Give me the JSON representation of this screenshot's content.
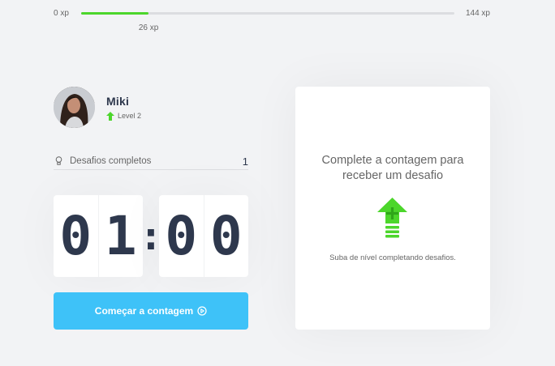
{
  "xp": {
    "min_label": "0 xp",
    "max_label": "144 xp",
    "current_label": "26 xp",
    "current": 26,
    "max": 144,
    "fill_color": "#4cd62b"
  },
  "profile": {
    "name": "Miki",
    "level_label": "Level 2",
    "level_icon": "level-up-arrow-icon"
  },
  "challenges": {
    "label": "Desafios completos",
    "count": "1",
    "icon": "lightbulb-icon"
  },
  "countdown": {
    "minute_left": "0",
    "minute_right": "1",
    "separator": ":",
    "second_left": "0",
    "second_right": "0"
  },
  "start_button": {
    "label": "Começar a contagem",
    "icon": "play-circle-icon",
    "color": "#3ec2f8"
  },
  "challenge_box": {
    "title_line1": "Complete a contagem para",
    "title_line2": "receber um desafio",
    "hint": "Suba de nível completando desafios.",
    "icon": "level-up-icon"
  },
  "colors": {
    "background": "#f2f3f5",
    "title_text": "#2e384d",
    "text": "#666666",
    "green": "#4cd62b"
  }
}
